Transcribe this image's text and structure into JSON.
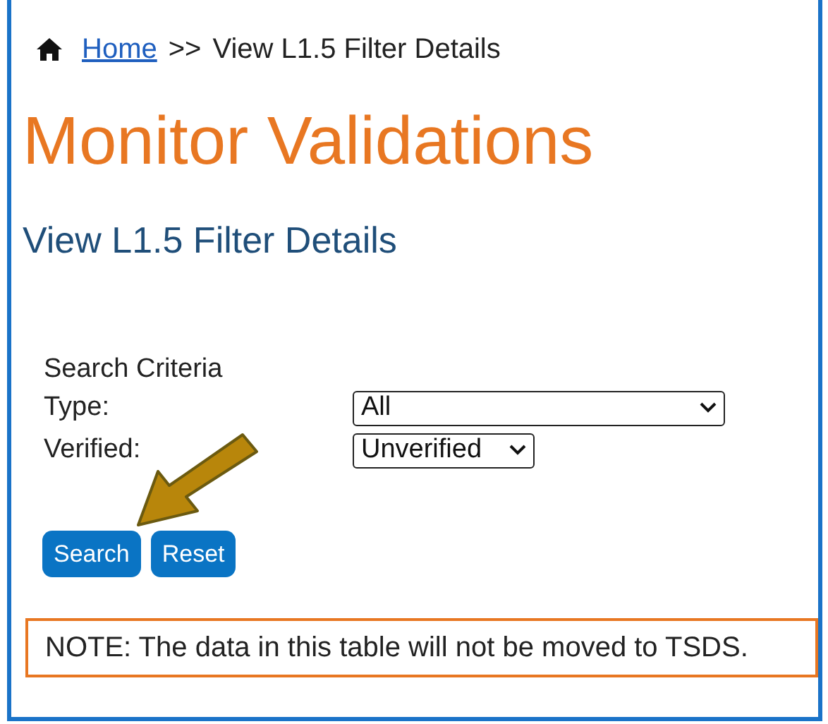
{
  "breadcrumb": {
    "link": "Home",
    "separator": ">>",
    "current": "View L1.5 Filter Details"
  },
  "page_title": "Monitor Validations",
  "subtitle": "View L1.5 Filter Details",
  "search_criteria": {
    "heading": "Search Criteria",
    "fields": [
      {
        "label": "Type:",
        "value": "All"
      },
      {
        "label": "Verified:",
        "value": "Unverified"
      }
    ]
  },
  "buttons": [
    "Search",
    "Reset"
  ],
  "note": "NOTE: The data in this table will not be moved to TSDS."
}
